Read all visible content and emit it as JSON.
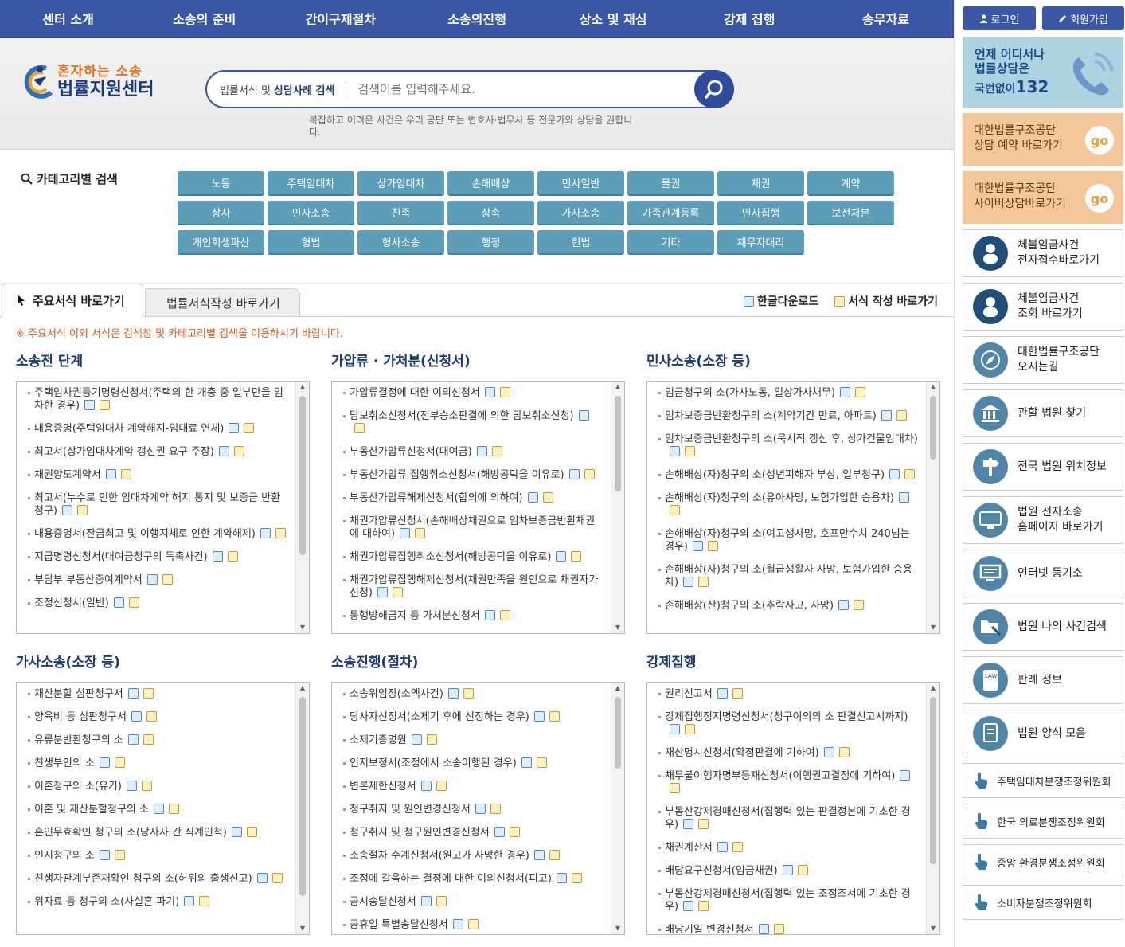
{
  "nav": [
    "센터 소개",
    "소송의 준비",
    "간이구제절차",
    "소송의진행",
    "상소 및 재심",
    "강제 집행",
    "송무자료"
  ],
  "logo": {
    "line1": "혼자하는 소송",
    "line2": "법률지원센터"
  },
  "search": {
    "label_pre": "법률서식 및 ",
    "label_bold": "상담사례 검색",
    "placeholder": "검색어를 입력해주세요.",
    "note": "복잡하고 어려운 사건은 우리 공단 또는 변호사·법무사 등 전문가와 상담을 권합니다."
  },
  "category": {
    "title": "카테고리별 검색",
    "items": [
      "노동",
      "주택임대차",
      "상가임대차",
      "손해배상",
      "민사일반",
      "물권",
      "채권",
      "계약",
      "상사",
      "민사소송",
      "친족",
      "상속",
      "가사소송",
      "가족관계등록",
      "민사집행",
      "보전처분",
      "개인회생파산",
      "형법",
      "형사소송",
      "행정",
      "헌법",
      "기타",
      "채무자대리"
    ]
  },
  "tabs": {
    "tab1": "주요서식 바로가기",
    "tab2": "법률서식작성 바로가기",
    "link1": "한글다운로드",
    "link2": "서식 작성 바로가기"
  },
  "notice": "※ 주요서식 이외 서식은 검색창 및 카테고리별 검색을 이용하시기 바랍니다.",
  "boxes": [
    {
      "title": "소송전 단계",
      "items": [
        "주택임차권등기명령신청서(주택의 한 개층 중 일부만을 임차한 경우)",
        "내용증명(주택임대차 계약해지-임대료 연체)",
        "최고서(상가임대차계약 갱신권 요구 주장)",
        "채권양도계약서",
        "최고서(누수로 인한 임대차계약 해지 통지 및 보증금 반환청구)",
        "내용증명서(잔금최고 및 이행지체로 인한 계약해제)",
        "지급명령신청서(대여금청구의 독촉사건)",
        "부담부 부동산증여계약서",
        "조정신청서(일반)"
      ]
    },
    {
      "title": "가압류 · 가처분(신청서)",
      "items": [
        "가압류결정에 대한 이의신청서",
        "담보취소신청서(전부승소판결에 의한 담보취소신청)",
        "부동산가압류신청서(대여금)",
        "부동산가압류 집행취소신청서(해방공탁을 이유로)",
        "부동산가압류해제신청서(합의에 의하여)",
        "채권가압류신청서(손해배상채권으로 임차보증금반환채권에 대하여)",
        "채권가압류집행취소신청서(해방공탁을 이유로)",
        "채권가압류집행해제신청서(채권만족을 원인으로 채권자가 신청)",
        "통행방해금지 등 가처분신청서"
      ]
    },
    {
      "title": "민사소송(소장 등)",
      "items": [
        "임금청구의 소(가사노동, 일상가사채무)",
        "임차보증금반환청구의 소(계약기간 만료, 아파트)",
        "임차보증금반환청구의 소(묵시적 갱신 후, 상가건물임대차)",
        "손해배상(자)청구의 소(성년피해자 부상, 일부청구)",
        "손해배상(자)청구의 소(유아사망, 보험가입한 승용차)",
        "손해배상(자)청구의 소(여고생사망, 호프만수치 240넘는 경우)",
        "손해배상(자)청구의 소(월급생활자 사망, 보험가입한 승용차)",
        "손해배상(산)청구의 소(추락사고, 사망)"
      ]
    },
    {
      "title": "가사소송(소장 등)",
      "items": [
        "재산분할 심판청구서",
        "양육비 등 심판청구서",
        "유류분반환청구의 소",
        "친생부인의 소",
        "이혼청구의 소(유기)",
        "이혼 및 재산분할청구의 소",
        "혼인무효확인 청구의 소(당사자 간 직계인척)",
        "인지청구의 소",
        "친생자관계부존재확인 청구의 소(허위의 출생신고)",
        "위자료 등 청구의 소(사실혼 파기)"
      ]
    },
    {
      "title": "소송진행(절차)",
      "items": [
        "소송위임장(소액사건)",
        "당사자선정서(소제기 후에 선정하는 경우)",
        "소제기증명원",
        "인지보정서(조정에서 소송이행된 경우)",
        "변론제한신청서",
        "청구취지 및 원인변경신청서",
        "청구취지 및 청구원인변경신청서",
        "소송절차 수계신청서(원고가 사망한 경우)",
        "조정에 갈음하는 결정에 대한 이의신청서(피고)",
        "공시송달신청서",
        "공휴일 특별송달신청서"
      ]
    },
    {
      "title": "강제집행",
      "items": [
        "권리신고서",
        "강제집행정지명령신청서(청구이의의 소 판결선고시까지)",
        "재산명시신청서(확정판결에 기하여)",
        "채무불이행자명부등재신청서(이행권고결정에 기하여)",
        "부동산강제경매신청서(집행력 있는 판결정본에 기초한 경우)",
        "채권계산서",
        "배당요구신청서(임금채권)",
        "부동산강제경매신청서(집행력 있는 조정조서에 기초한 경우)",
        "배당기일 변경신청서"
      ]
    }
  ],
  "side": {
    "login": "로그인",
    "join": "회원가입",
    "banner": {
      "line1": "언제 어디서나",
      "line2": "법률상담은",
      "line3": "국번없이",
      "number": "132"
    },
    "go1": {
      "line1": "대한법률구조공단",
      "line2": "상담 예약 바로가기",
      "go": "go"
    },
    "go2": {
      "line1": "대한법률구조공단",
      "line2": "사이버상담바로가기",
      "go": "go"
    },
    "buttons": [
      {
        "l1": "체불임금사건",
        "l2": "전자접수바로가기",
        "icon": "person-icon"
      },
      {
        "l1": "체불임금사건",
        "l2": "조회 바로가기",
        "icon": "person-icon"
      },
      {
        "l1": "대한법률구조공단",
        "l2": "오시는길",
        "icon": "compass-icon"
      },
      {
        "l1": "관할 법원 찾기",
        "l2": "",
        "icon": "court-icon"
      },
      {
        "l1": "전국 법원 위치정보",
        "l2": "",
        "icon": "signpost-icon"
      },
      {
        "l1": "법원 전자소송",
        "l2": "홈페이지 바로가기",
        "icon": "monitor-icon"
      },
      {
        "l1": "인터넷 등기소",
        "l2": "",
        "icon": "computer-icon"
      },
      {
        "l1": "법원 나의 사건검색",
        "l2": "",
        "icon": "folder-search-icon"
      },
      {
        "l1": "판례 정보",
        "l2": "",
        "icon": "law-book-icon"
      },
      {
        "l1": "법원 양식 모음",
        "l2": "",
        "icon": "document-icon"
      }
    ],
    "orgs": [
      "주택임대차분쟁조정위원회",
      "한국 의료분쟁조정위원회",
      "중앙 환경분쟁조정위원회",
      "소비자분쟁조정위원회"
    ]
  }
}
